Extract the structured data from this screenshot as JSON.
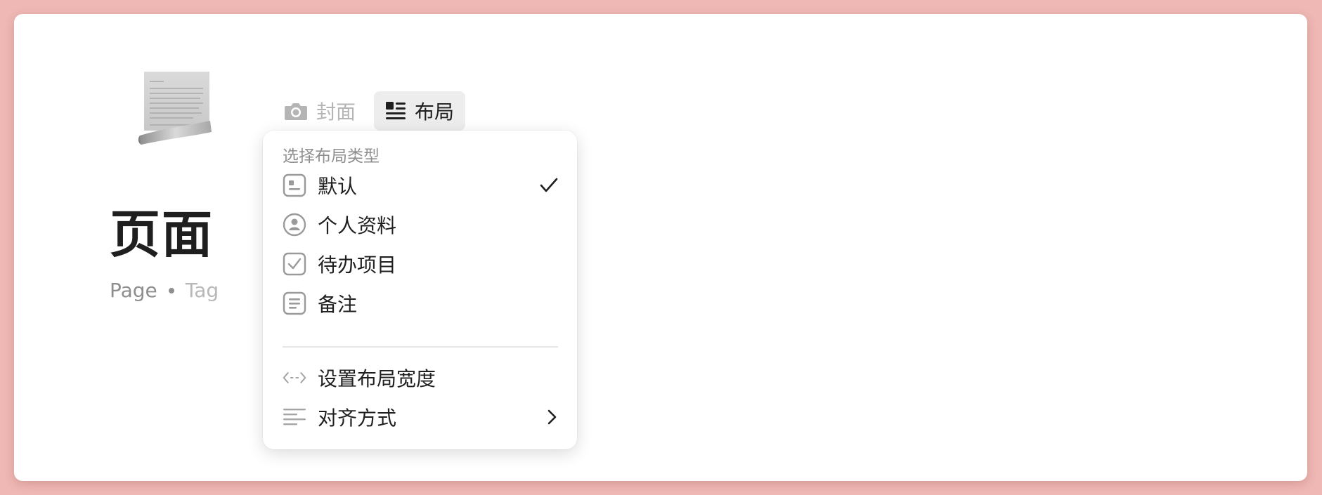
{
  "page": {
    "title": "页面",
    "type_label": "Page",
    "tag_label": "Tag",
    "icon": "scroll-document-icon"
  },
  "toolbar": {
    "cover_label": "封面",
    "layout_label": "布局"
  },
  "layout_menu": {
    "heading": "选择布局类型",
    "types": [
      {
        "label": "默认",
        "icon": "layout-default-icon",
        "selected": true
      },
      {
        "label": "个人资料",
        "icon": "profile-icon",
        "selected": false
      },
      {
        "label": "待办项目",
        "icon": "todo-checkbox-icon",
        "selected": false
      },
      {
        "label": "备注",
        "icon": "note-icon",
        "selected": false
      }
    ],
    "actions": [
      {
        "label": "设置布局宽度",
        "icon": "width-arrows-icon"
      },
      {
        "label": "对齐方式",
        "icon": "align-left-icon",
        "has_submenu": true
      }
    ]
  },
  "colors": {
    "background": "#efb8b4",
    "window": "#ffffff",
    "active_button": "#ededed",
    "muted_text": "#8f8f8f"
  }
}
